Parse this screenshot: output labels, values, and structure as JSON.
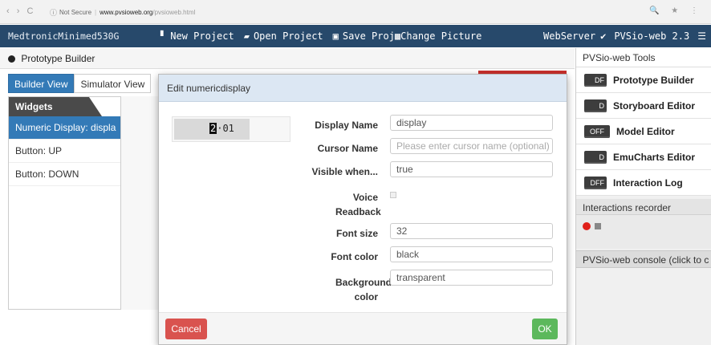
{
  "browser": {
    "nav_glyphs": "‹ › C",
    "security_icon": "info-icon",
    "security_label": "Not Secure",
    "host": "www.pvsioweb.org",
    "path": "/pvsioweb.html",
    "right_icons": "🔍 ★ ⋮"
  },
  "topbar": {
    "brand": "MedtronicMinimed530G",
    "new_project": "New Project",
    "open_project": "Open Project",
    "save_project": "Save Proj",
    "change_picture": "Change Picture",
    "webserver": "WebServer",
    "webserver_check": "✔",
    "version": "PVSio-web 2.3",
    "hamburger": "☰"
  },
  "prototype": {
    "header": "Prototype Builder",
    "tabs": [
      "Builder View",
      "Simulator View"
    ],
    "widgets_title": "Widgets",
    "widgets": [
      "Numeric Display: displa",
      "Button: UP",
      "Button: DOWN"
    ]
  },
  "tools": {
    "title": "PVSio-web Tools",
    "items": [
      {
        "badge": "DF",
        "label": "Prototype Builder"
      },
      {
        "badge": "D",
        "label": "Storyboard Editor"
      },
      {
        "badge": "OFF",
        "label": "Model Editor"
      },
      {
        "badge": "D",
        "label": "EmuCharts Editor"
      },
      {
        "badge": "DFF",
        "label": "Interaction Log"
      }
    ],
    "recorder_title": "Interactions recorder",
    "console_title": "PVSio-web console (click to c"
  },
  "modal": {
    "title": "Edit numericdisplay",
    "preview": {
      "cursor_digit": "2",
      "rest": "·01"
    },
    "fields": {
      "display_name_label": "Display Name",
      "display_name_value": "display",
      "cursor_name_label": "Cursor Name",
      "cursor_name_placeholder": "Please enter cursor name (optional)",
      "visible_when_label": "Visible when...",
      "visible_when_value": "true",
      "voice_readback_label": "Voice Readback",
      "font_size_label": "Font size",
      "font_size_value": "32",
      "font_color_label": "Font color",
      "font_color_value": "black",
      "background_color_label": "Background color",
      "background_color_value": "transparent"
    },
    "cancel_label": "Cancel",
    "ok_label": "OK"
  },
  "colors": {
    "topbar": "#27496b",
    "primary": "#337ab7",
    "danger": "#d9534f",
    "success": "#5cb85c",
    "modal_header": "#dce7f3",
    "record": "#e0201a"
  }
}
